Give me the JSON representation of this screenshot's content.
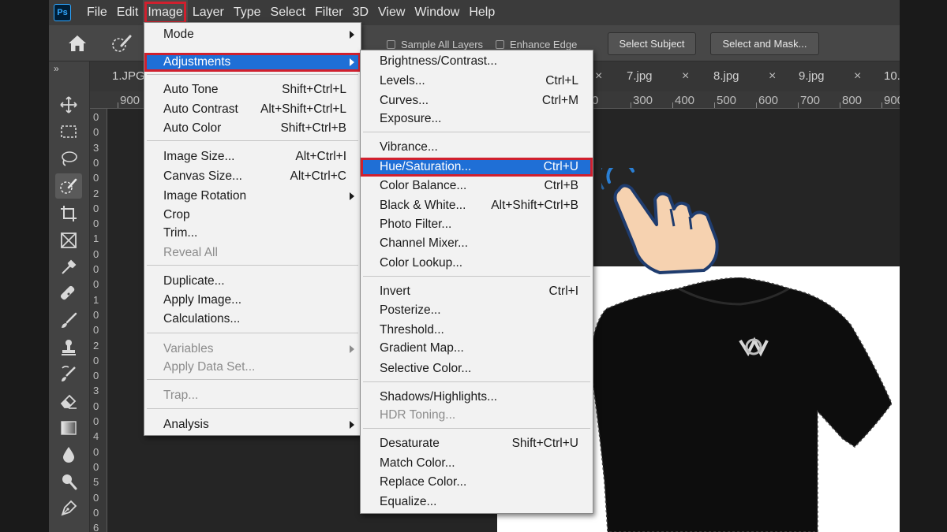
{
  "app": {
    "logo": "Ps",
    "menubar": [
      "File",
      "Edit",
      "Image",
      "Layer",
      "Type",
      "Select",
      "Filter",
      "3D",
      "View",
      "Window",
      "Help"
    ],
    "active_menu": "Image"
  },
  "options_bar": {
    "sample_all_layers": "Sample All Layers",
    "enhance_edge": "Enhance Edge",
    "select_subject": "Select Subject",
    "select_and_mask": "Select and Mask..."
  },
  "toolbar": {
    "collapse": "»",
    "tools": [
      "move-tool",
      "marquee-tool",
      "lasso-tool",
      "quick-selection-tool",
      "crop-tool",
      "frame-tool",
      "eyedropper-tool",
      "healing-brush-tool",
      "brush-tool",
      "clone-stamp-tool",
      "history-brush-tool",
      "eraser-tool",
      "gradient-tool",
      "blur-tool",
      "dodge-tool",
      "pen-tool"
    ],
    "selected": "quick-selection-tool"
  },
  "tabs": [
    "1.JPG",
    "7.jpg",
    "8.jpg",
    "9.jpg",
    "10."
  ],
  "ruler_h": [
    "900",
    "0",
    "300",
    "400",
    "500",
    "600",
    "700",
    "800",
    "900"
  ],
  "ruler_v": [
    "0",
    "0",
    "3",
    "0",
    "0",
    "2",
    "0",
    "0",
    "1",
    "0",
    "0",
    "0",
    "1",
    "0",
    "0",
    "2",
    "0",
    "0",
    "3",
    "0",
    "0",
    "4",
    "0",
    "0",
    "5",
    "0",
    "0",
    "6"
  ],
  "image_menu": {
    "items": [
      {
        "label": "Mode",
        "shortcut": "",
        "submenu": true
      },
      {
        "label": "Adjustments",
        "shortcut": "",
        "submenu": true,
        "highlighted": true
      },
      {
        "label": "Auto Tone",
        "shortcut": "Shift+Ctrl+L"
      },
      {
        "label": "Auto Contrast",
        "shortcut": "Alt+Shift+Ctrl+L"
      },
      {
        "label": "Auto Color",
        "shortcut": "Shift+Ctrl+B"
      },
      {
        "label": "Image Size...",
        "shortcut": "Alt+Ctrl+I"
      },
      {
        "label": "Canvas Size...",
        "shortcut": "Alt+Ctrl+C"
      },
      {
        "label": "Image Rotation",
        "shortcut": "",
        "submenu": true
      },
      {
        "label": "Crop",
        "shortcut": ""
      },
      {
        "label": "Trim...",
        "shortcut": ""
      },
      {
        "label": "Reveal All",
        "shortcut": "",
        "disabled": true
      },
      {
        "label": "Duplicate...",
        "shortcut": ""
      },
      {
        "label": "Apply Image...",
        "shortcut": ""
      },
      {
        "label": "Calculations...",
        "shortcut": ""
      },
      {
        "label": "Variables",
        "shortcut": "",
        "submenu": true,
        "disabled": true
      },
      {
        "label": "Apply Data Set...",
        "shortcut": "",
        "disabled": true
      },
      {
        "label": "Trap...",
        "shortcut": "",
        "disabled": true
      },
      {
        "label": "Analysis",
        "shortcut": "",
        "submenu": true
      }
    ]
  },
  "adjustments_menu": {
    "items": [
      {
        "label": "Brightness/Contrast...",
        "shortcut": ""
      },
      {
        "label": "Levels...",
        "shortcut": "Ctrl+L"
      },
      {
        "label": "Curves...",
        "shortcut": "Ctrl+M"
      },
      {
        "label": "Exposure...",
        "shortcut": ""
      },
      {
        "label": "Vibrance...",
        "shortcut": ""
      },
      {
        "label": "Hue/Saturation...",
        "shortcut": "Ctrl+U",
        "highlighted": true
      },
      {
        "label": "Color Balance...",
        "shortcut": "Ctrl+B"
      },
      {
        "label": "Black & White...",
        "shortcut": "Alt+Shift+Ctrl+B"
      },
      {
        "label": "Photo Filter...",
        "shortcut": ""
      },
      {
        "label": "Channel Mixer...",
        "shortcut": ""
      },
      {
        "label": "Color Lookup...",
        "shortcut": ""
      },
      {
        "label": "Invert",
        "shortcut": "Ctrl+I"
      },
      {
        "label": "Posterize...",
        "shortcut": ""
      },
      {
        "label": "Threshold...",
        "shortcut": ""
      },
      {
        "label": "Gradient Map...",
        "shortcut": ""
      },
      {
        "label": "Selective Color...",
        "shortcut": ""
      },
      {
        "label": "Shadows/Highlights...",
        "shortcut": ""
      },
      {
        "label": "HDR Toning...",
        "shortcut": "",
        "disabled": true
      },
      {
        "label": "Desaturate",
        "shortcut": "Shift+Ctrl+U"
      },
      {
        "label": "Match Color...",
        "shortcut": ""
      },
      {
        "label": "Replace Color...",
        "shortcut": ""
      },
      {
        "label": "Equalize...",
        "shortcut": ""
      }
    ]
  },
  "colors": {
    "highlight": "#1f6fd6",
    "callout_red": "#d0202e",
    "ps_blue": "#31a8ff"
  }
}
